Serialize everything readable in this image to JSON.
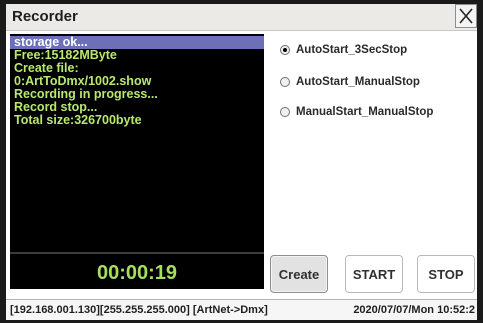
{
  "window": {
    "title": "Recorder",
    "close_icon": "close-icon"
  },
  "log": {
    "lines": [
      "storage ok...",
      "Free:15182MByte",
      "Create file:",
      "0:ArtToDmx/1002.show",
      "Recording in progress...",
      "Record stop...",
      "Total size:326700byte"
    ],
    "selected_index": 0
  },
  "timer": "00:00:19",
  "modes": [
    {
      "label": "AutoStart_3SecStop",
      "checked": true
    },
    {
      "label": "AutoStart_ManualStop",
      "checked": false
    },
    {
      "label": "ManualStart_ManualStop",
      "checked": false
    }
  ],
  "buttons": {
    "create": "Create",
    "start": "START",
    "stop": "STOP"
  },
  "status": {
    "network": "[192.168.001.130][255.255.255.000] [ArtNet->Dmx]",
    "datetime": "2020/07/07/Mon 10:52:2"
  },
  "colors": {
    "log_text": "#b9e86f",
    "log_selected_bg": "#6d6fb8",
    "timer_text": "#a6df5c",
    "panel_bg": "#000000"
  }
}
